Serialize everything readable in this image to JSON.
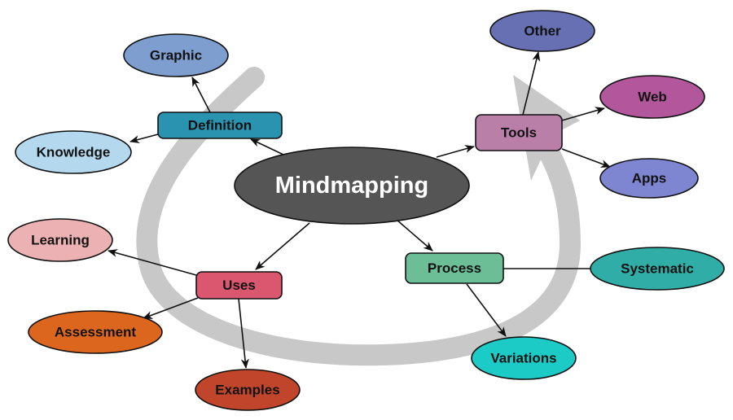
{
  "diagram": {
    "type": "mindmap",
    "center": {
      "id": "mindmapping",
      "label": "Mindmapping",
      "color": "#555555"
    },
    "cycle_arrow": {
      "color": "#c8c8c8",
      "direction": "clockwise"
    },
    "branches": [
      {
        "id": "definition",
        "label": "Definition",
        "color": "#2a93b0",
        "children": [
          {
            "id": "graphic",
            "label": "Graphic",
            "color": "#7d9ecf"
          },
          {
            "id": "knowledge",
            "label": "Knowledge",
            "color": "#b4d9ef"
          }
        ]
      },
      {
        "id": "tools",
        "label": "Tools",
        "color": "#b97fa8",
        "children": [
          {
            "id": "other",
            "label": "Other",
            "color": "#6670b2"
          },
          {
            "id": "web",
            "label": "Web",
            "color": "#b3579c"
          },
          {
            "id": "apps",
            "label": "Apps",
            "color": "#7f86d1"
          }
        ]
      },
      {
        "id": "uses",
        "label": "Uses",
        "color": "#db566f",
        "children": [
          {
            "id": "learning",
            "label": "Learning",
            "color": "#ecb2b3"
          },
          {
            "id": "assessment",
            "label": "Assessment",
            "color": "#dd661e"
          },
          {
            "id": "examples",
            "label": "Examples",
            "color": "#c0452a"
          }
        ]
      },
      {
        "id": "process",
        "label": "Process",
        "color": "#6cbe97",
        "children": [
          {
            "id": "systematic",
            "label": "Systematic",
            "color": "#30ada6",
            "arrow": false
          },
          {
            "id": "variations",
            "label": "Variations",
            "color": "#1ccbc6"
          }
        ]
      }
    ]
  }
}
